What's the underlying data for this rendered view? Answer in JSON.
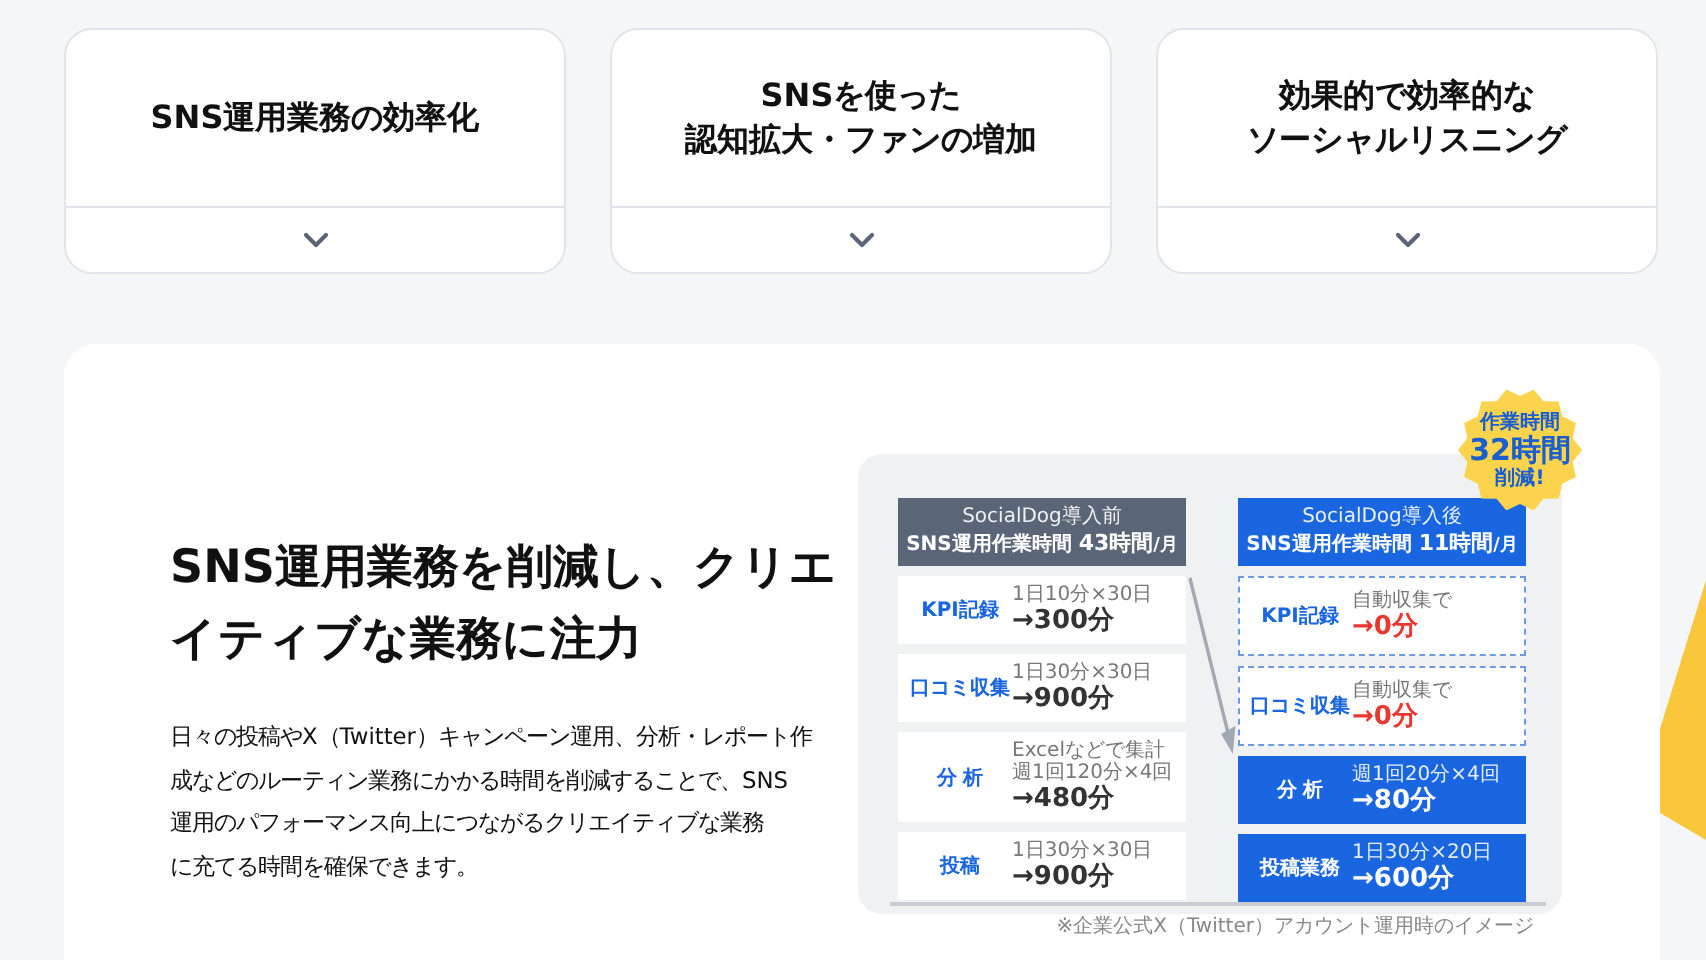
{
  "cards": [
    {
      "title_lines": [
        "SNS運用業務の効率化"
      ],
      "expanded": false
    },
    {
      "title_lines": [
        "SNSを使った",
        "認知拡大・ファンの増加"
      ],
      "expanded": false
    },
    {
      "title_lines": [
        "効果的で効率的な",
        "ソーシャルリスニング"
      ],
      "expanded": false
    }
  ],
  "feature": {
    "heading_lines": [
      "SNS運用業務を削減し、クリエ",
      "イティブな業務に注力"
    ],
    "body_lines": [
      "日々の投稿やX（Twitter）キャンペーン運用、分析・レポート作",
      "成などのルーティン業務にかかる時間を削減することで、SNS",
      "運用のパフォーマンス向上につながるクリエイティブな業務",
      "に充てる時間を確保できます。"
    ],
    "diagram": {
      "badge": {
        "top": "作業時間",
        "big": "32時間",
        "bottom": "削減!"
      },
      "before": {
        "caption": "SocialDog導入前",
        "label": "SNS運用作業時間",
        "hours": "43時間",
        "unit": "/月",
        "rows": [
          {
            "kind": "plain",
            "label": "KPI記録",
            "notes": [
              "1日10分×30日"
            ],
            "value": "→300分"
          },
          {
            "kind": "plain",
            "label": "口コミ収集",
            "notes": [
              "1日30分×30日"
            ],
            "value": "→900分"
          },
          {
            "kind": "plain",
            "label": "分 析",
            "notes": [
              "Excelなどで集計",
              "週1回120分×4回"
            ],
            "value": "→480分"
          },
          {
            "kind": "plain",
            "label": "投稿",
            "notes": [
              "1日30分×30日"
            ],
            "value": "→900分"
          }
        ]
      },
      "after": {
        "caption": "SocialDog導入後",
        "label": "SNS運用作業時間",
        "hours": "11時間",
        "unit": "/月",
        "rows": [
          {
            "kind": "removed",
            "label": "KPI記録",
            "notes": [
              "自動収集で"
            ],
            "value": "→0分"
          },
          {
            "kind": "removed",
            "label": "口コミ収集",
            "notes": [
              "自動収集で"
            ],
            "value": "→0分"
          },
          {
            "kind": "filled",
            "label": "分 析",
            "notes": [
              "週1回20分×4回"
            ],
            "value": "→80分"
          },
          {
            "kind": "filled",
            "label": "投稿業務",
            "notes": [
              "1日30分×20日"
            ],
            "value": "→600分"
          }
        ]
      },
      "note": "※企業公式X（Twitter）アカウント運用時のイメージ"
    }
  }
}
